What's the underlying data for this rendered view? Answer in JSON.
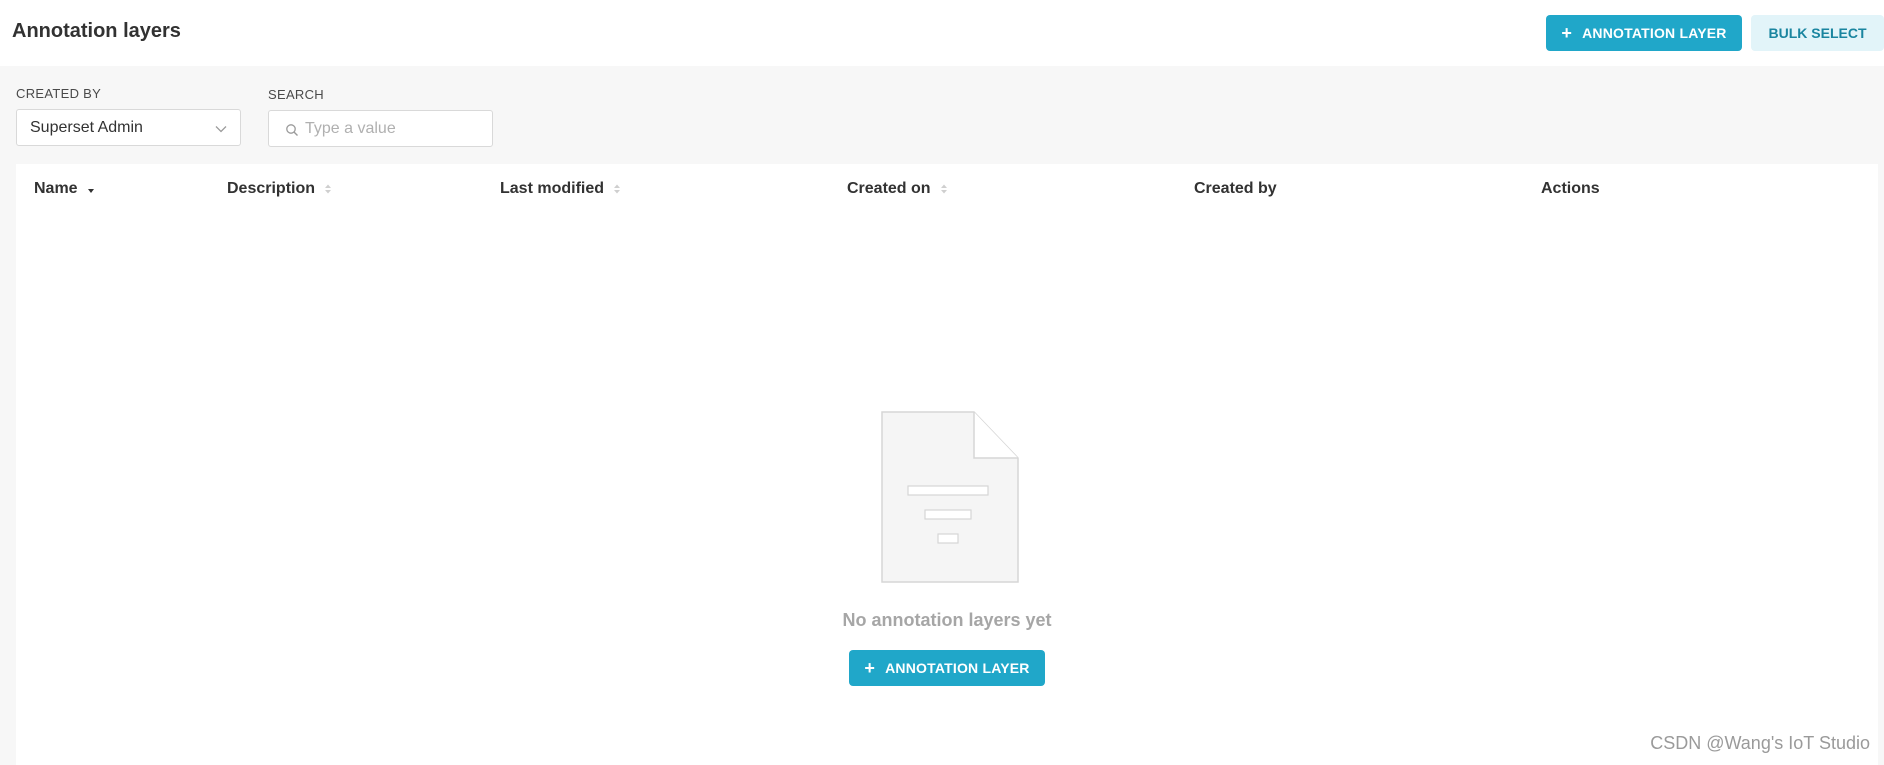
{
  "header": {
    "title": "Annotation layers",
    "add_label": "ANNOTATION LAYER",
    "bulk_select_label": "BULK SELECT"
  },
  "filters": {
    "created_by": {
      "label": "CREATED BY",
      "value": "Superset Admin"
    },
    "search": {
      "label": "SEARCH",
      "placeholder": "Type a value"
    }
  },
  "table": {
    "columns": [
      {
        "label": "Name",
        "sortable": true,
        "sorted": "desc"
      },
      {
        "label": "Description",
        "sortable": true
      },
      {
        "label": "Last modified",
        "sortable": true
      },
      {
        "label": "Created on",
        "sortable": true
      },
      {
        "label": "Created by",
        "sortable": false
      },
      {
        "label": "Actions",
        "sortable": false
      }
    ]
  },
  "empty_state": {
    "message": "No annotation layers yet",
    "add_label": "ANNOTATION LAYER"
  },
  "watermark": "CSDN @Wang's IoT Studio",
  "colors": {
    "primary": "#20a7c9",
    "secondary_bg": "#e2f4f9",
    "secondary_text": "#1a85a0",
    "background": "#f7f7f7"
  }
}
